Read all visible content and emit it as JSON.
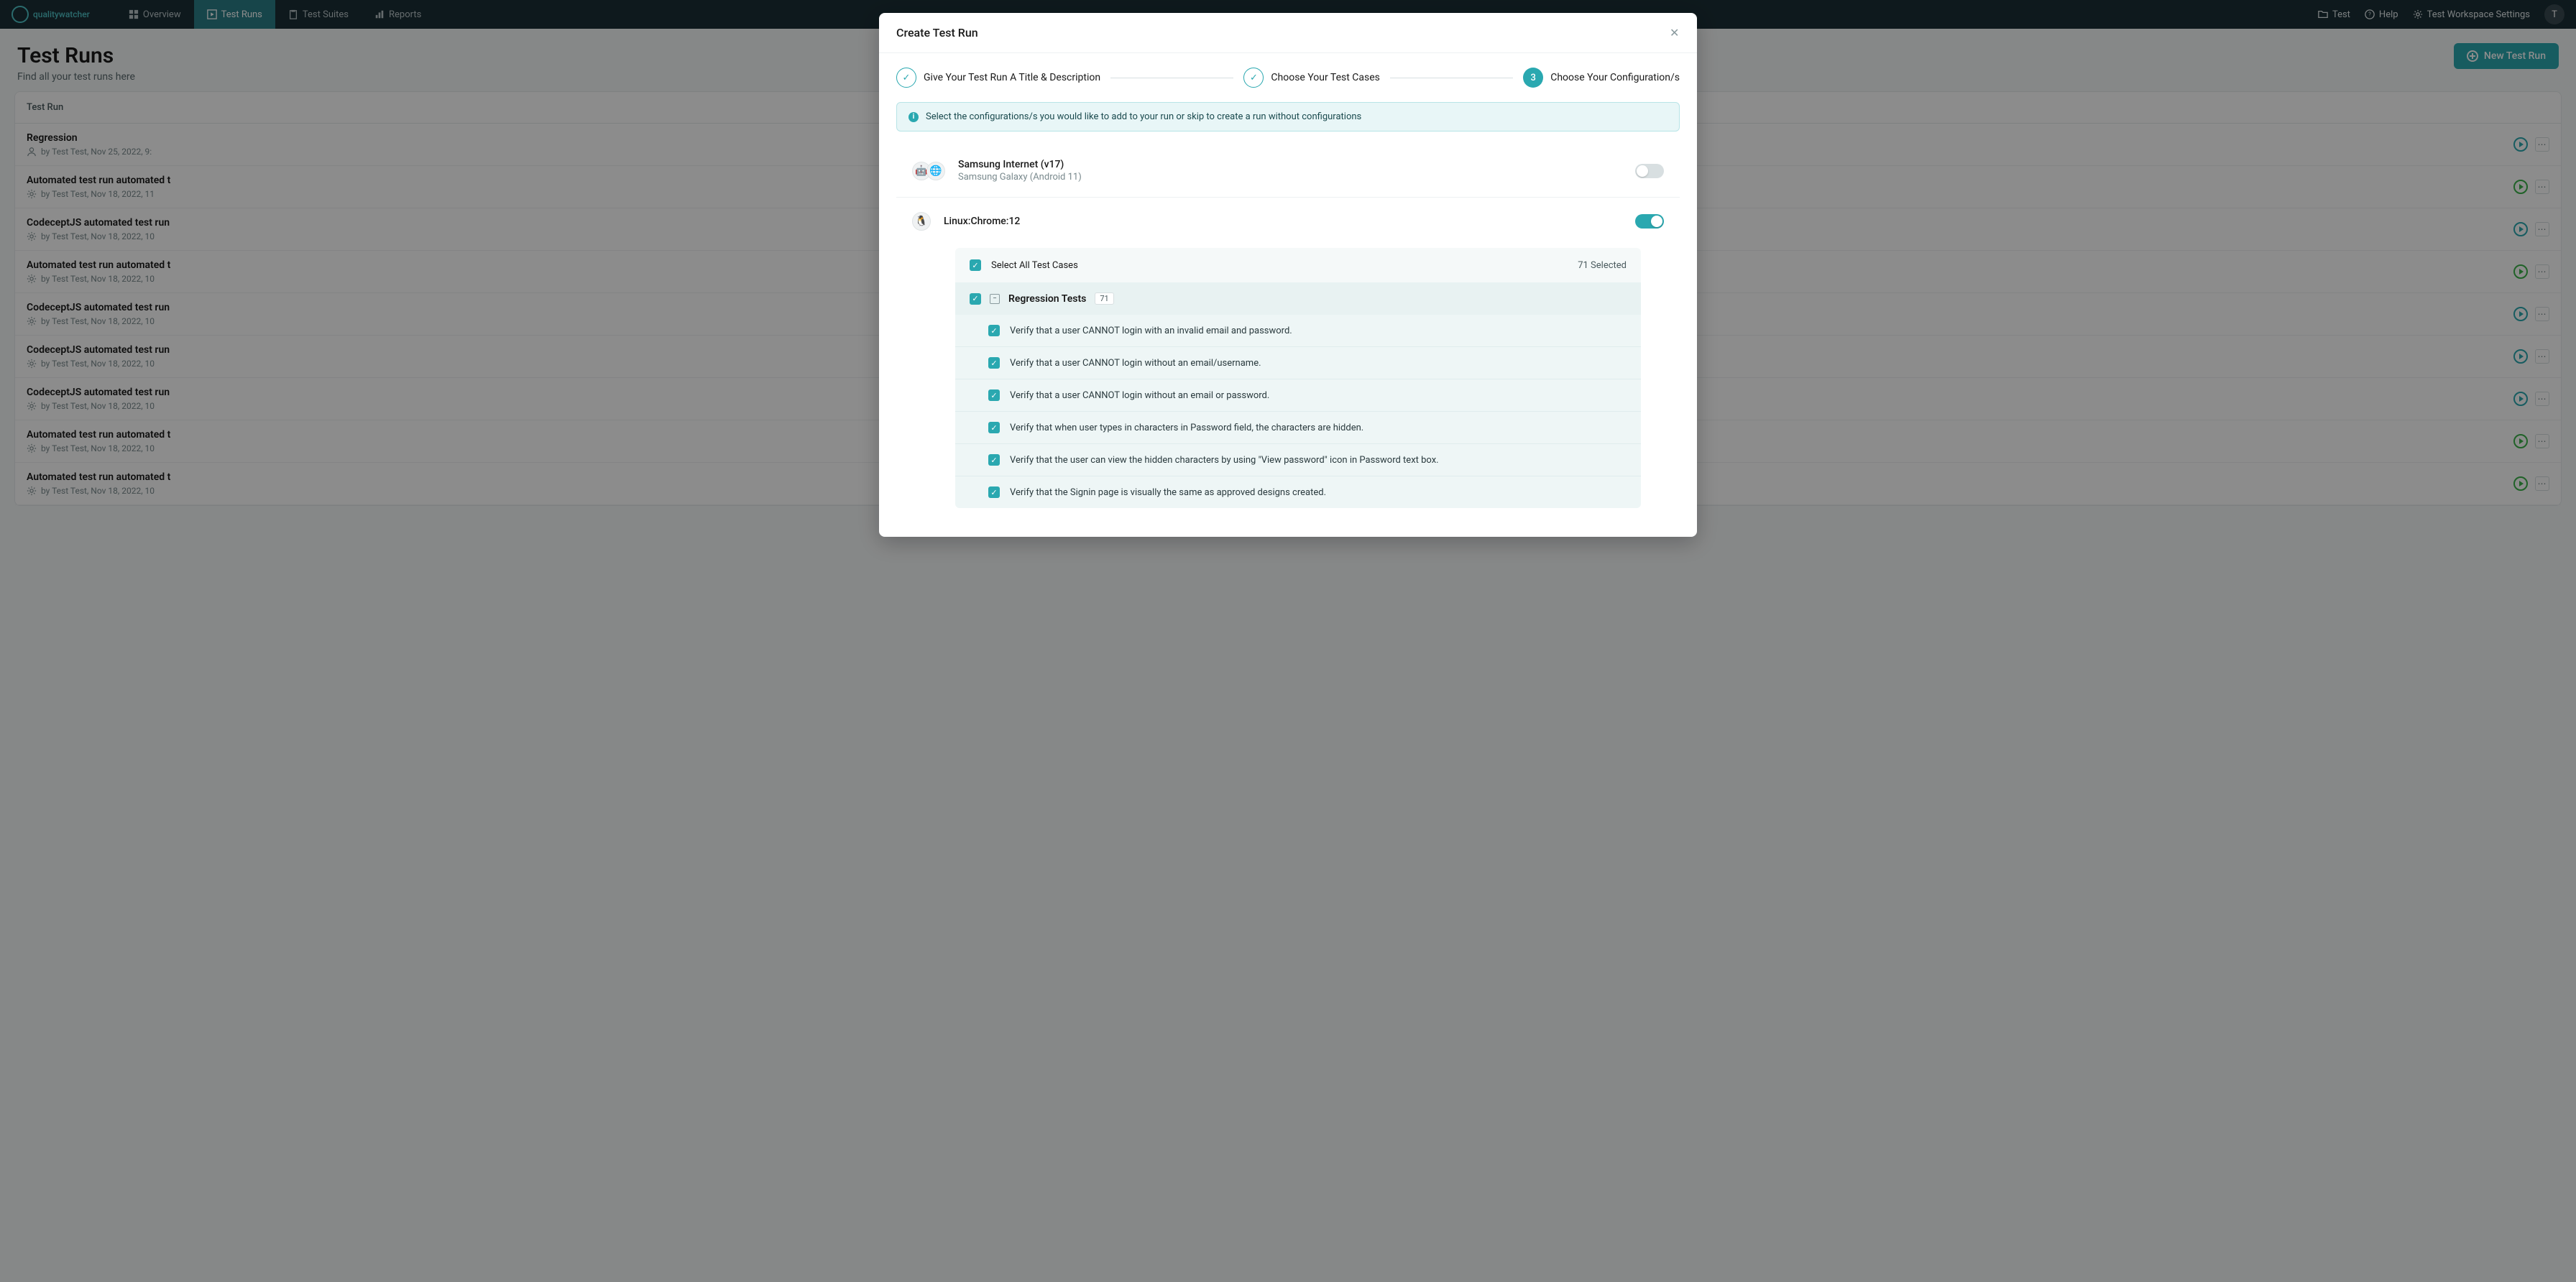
{
  "nav": {
    "brand": "qualitywatcher",
    "items": [
      {
        "label": "Overview",
        "active": false
      },
      {
        "label": "Test Runs",
        "active": true
      },
      {
        "label": "Test Suites",
        "active": false
      },
      {
        "label": "Reports",
        "active": false
      }
    ],
    "right": {
      "project": "Test",
      "help": "Help",
      "settings": "Test Workspace Settings",
      "avatar_initial": "T"
    }
  },
  "page": {
    "title": "Test Runs",
    "subtitle": "Find all your test runs here",
    "new_button": "New Test Run",
    "list_header": "Test Run",
    "runs": [
      {
        "title": "Regression",
        "meta": "by Test Test, Nov 25, 2022, 9:",
        "icon": "user",
        "play": "teal"
      },
      {
        "title": "Automated test run automated t",
        "meta": "by Test Test, Nov 18, 2022, 11",
        "icon": "gear",
        "play": "green"
      },
      {
        "title": "CodeceptJS automated test run",
        "meta": "by Test Test, Nov 18, 2022, 10",
        "icon": "gear",
        "play": "teal"
      },
      {
        "title": "Automated test run automated t",
        "meta": "by Test Test, Nov 18, 2022, 10",
        "icon": "gear",
        "play": "green"
      },
      {
        "title": "CodeceptJS automated test run",
        "meta": "by Test Test, Nov 18, 2022, 10",
        "icon": "gear",
        "play": "teal"
      },
      {
        "title": "CodeceptJS automated test run",
        "meta": "by Test Test, Nov 18, 2022, 10",
        "icon": "gear",
        "play": "teal"
      },
      {
        "title": "CodeceptJS automated test run",
        "meta": "by Test Test, Nov 18, 2022, 10",
        "icon": "gear",
        "play": "teal"
      },
      {
        "title": "Automated test run automated t",
        "meta": "by Test Test, Nov 18, 2022, 10",
        "icon": "gear",
        "play": "green"
      },
      {
        "title": "Automated test run automated t",
        "meta": "by Test Test, Nov 18, 2022, 10",
        "icon": "gear",
        "play": "green"
      }
    ]
  },
  "modal": {
    "title": "Create Test Run",
    "steps": [
      {
        "label": "Give Your Test Run A Title & Description",
        "state": "done"
      },
      {
        "label": "Choose Your Test Cases",
        "state": "done"
      },
      {
        "num": "3",
        "label": "Choose Your Configuration/s",
        "state": "active"
      }
    ],
    "info": "Select the configurations/s you would like to add to your run or skip to create a run without configurations",
    "configs": [
      {
        "name": "Samsung Internet (v17)",
        "sub": "Samsung Galaxy (Android 11)",
        "enabled": false,
        "icons": [
          "android",
          "browser"
        ]
      },
      {
        "name": "Linux:Chrome:12",
        "sub": "",
        "enabled": true,
        "icons": [
          "linux"
        ]
      }
    ],
    "tc": {
      "select_all_label": "Select All Test Cases",
      "selected_text": "71 Selected",
      "group_title": "Regression Tests",
      "group_count": "71",
      "cases": [
        "Verify that a user CANNOT login with an invalid email and password.",
        "Verify that a user CANNOT login without an email/username.",
        "Verify that a user CANNOT login without an email or password.",
        "Verify that when user types in characters in Password field, the characters are hidden.",
        "Verify that the user can view the hidden characters by using \"View password\" icon in Password text box.",
        "Verify that the Signin page is visually the same as approved designs created."
      ]
    }
  }
}
